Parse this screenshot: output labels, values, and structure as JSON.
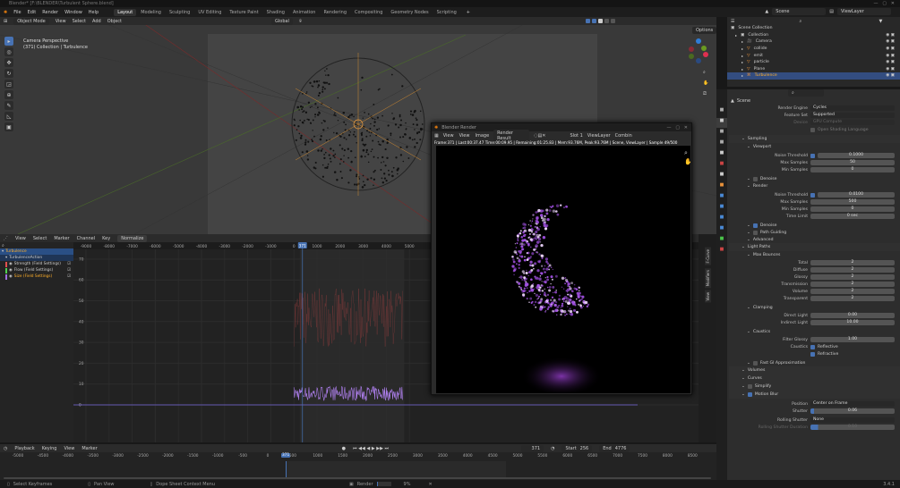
{
  "title": "Blender* [F:\\BLENDER\\Turbulent Sphere.blend]",
  "menu": [
    "File",
    "Edit",
    "Render",
    "Window",
    "Help"
  ],
  "workspaces": [
    "Layout",
    "Modeling",
    "Sculpting",
    "UV Editing",
    "Texture Paint",
    "Shading",
    "Animation",
    "Rendering",
    "Compositing",
    "Geometry Nodes",
    "Scripting"
  ],
  "active_workspace": "Layout",
  "scene": "Scene",
  "view_layer": "ViewLayer",
  "viewport": {
    "mode": "Object Mode",
    "menus": [
      "View",
      "Select",
      "Add",
      "Object"
    ],
    "orientation": "Global",
    "options": "Options",
    "overlay_line1": "Camera Perspective",
    "overlay_line2": "(371) Collection | Turbulence"
  },
  "outliner": {
    "root": "Scene Collection",
    "items": [
      "Collection",
      "Camera",
      "collide",
      "emit",
      "particle",
      "Plane",
      "Turbulence"
    ],
    "selected": "Turbulence"
  },
  "properties": {
    "scene_label": "Scene",
    "rows1": [
      [
        "Render Engine",
        "Cycles",
        "dd"
      ],
      [
        "Feature Set",
        "Supported",
        "dd"
      ],
      [
        "Device",
        "GPU Compute",
        "dis"
      ]
    ],
    "osl": "Open Shading Language",
    "sampling": "Sampling",
    "viewport": "Viewport",
    "vp_rows": [
      [
        "Noise Threshold",
        "0.1000",
        "cb"
      ],
      [
        "Max Samples",
        "50",
        ""
      ],
      [
        "Min Samples",
        "0",
        ""
      ]
    ],
    "denoise": "Denoise",
    "render": "Render",
    "r_rows": [
      [
        "Noise Threshold",
        "0.0100",
        "cb"
      ],
      [
        "Max Samples",
        "500",
        ""
      ],
      [
        "Min Samples",
        "0",
        ""
      ],
      [
        "Time Limit",
        "0 sec",
        ""
      ]
    ],
    "denoise2": "Denoise",
    "path_guiding": "Path Guiding",
    "advanced": "Advanced",
    "light_paths": "Light Paths",
    "max_bounces": "Max Bounces",
    "bounce_rows": [
      [
        "Total",
        "2"
      ],
      [
        "Diffuse",
        "2"
      ],
      [
        "Glossy",
        "2"
      ],
      [
        "Transmission",
        "2"
      ],
      [
        "Volume",
        "2"
      ],
      [
        "Transparent",
        "2"
      ]
    ],
    "clamping": "Clamping",
    "clamp_rows": [
      [
        "Direct Light",
        "0.00"
      ],
      [
        "Indirect Light",
        "10.00"
      ]
    ],
    "caustics": "Caustics",
    "filter_glossy_label": "Filter Glossy",
    "filter_glossy": "1.00",
    "caustics_label": "Caustics",
    "reflective": "Reflective",
    "refractive": "Refractive",
    "fast_gi": "Fast GI Approximation",
    "volumes": "Volumes",
    "curves": "Curves",
    "simplify": "Simplify",
    "motion_blur": "Motion Blur",
    "position_label": "Position",
    "position": "Center on Frame",
    "shutter_label": "Shutter",
    "shutter": "0.06",
    "rolling_label": "Rolling Shutter",
    "rolling": "None",
    "rolling_dur_label": "Rolling Shutter Duration",
    "rolling_dur": "0.10"
  },
  "graph": {
    "menus": [
      "View",
      "Select",
      "Marker",
      "Channel",
      "Key"
    ],
    "normalize": "Normalize",
    "channels": [
      "Turbulence",
      "TurbulenceAction",
      "Strength (Field Settings)",
      "Flow (Field Settings)",
      "Size (Field Settings)"
    ],
    "channel_colors": [
      "#e05050",
      "#50d050",
      "#a070e0"
    ],
    "x_ticks": [
      "-9000",
      "-8000",
      "-7000",
      "-6000",
      "-5000",
      "-4000",
      "-3000",
      "-2000",
      "-1000",
      "0",
      "1000",
      "2000",
      "3000",
      "4000",
      "5000"
    ],
    "y_ticks": [
      "70",
      "60",
      "50",
      "40",
      "30",
      "20",
      "10",
      "0"
    ],
    "current_frame": "371",
    "side_tabs": [
      "F-Curve",
      "Modifiers",
      "View"
    ]
  },
  "render_window": {
    "title": "Blender Render",
    "menus": [
      "View",
      "View",
      "Image"
    ],
    "image": "Render Result",
    "slot": "Slot 1",
    "layer": "ViewLayer",
    "combined": "Combin",
    "stats": "Frame:371 | Last:00:37.47 Time:00:09.95 | Remaining:01:25.83 | Mem:93.76M, Peak:93.76M | Scene, ViewLayer | Sample 49/500"
  },
  "timeline": {
    "menus": [
      "Playback",
      "Keying",
      "View",
      "Marker"
    ],
    "frame": "371",
    "start": "Start",
    "start_val": "256",
    "end": "End",
    "end_val": "4776",
    "ticks": [
      "-5000",
      "-4500",
      "-4000",
      "-3500",
      "-3000",
      "-2500",
      "-2000",
      "-1500",
      "-1000",
      "-500",
      "0",
      "500",
      "1000",
      "1500",
      "2000",
      "2500",
      "3000",
      "3500",
      "4000",
      "4500",
      "5000",
      "5500",
      "6000",
      "6500",
      "7000",
      "7500",
      "8000",
      "8500"
    ]
  },
  "status": {
    "items": [
      "Select Keyframes",
      "Pan View",
      "Dope Sheet Context Menu"
    ],
    "render": "Render",
    "progress": "9%",
    "version": "3.4.1",
    "render_progress": 0.09
  }
}
